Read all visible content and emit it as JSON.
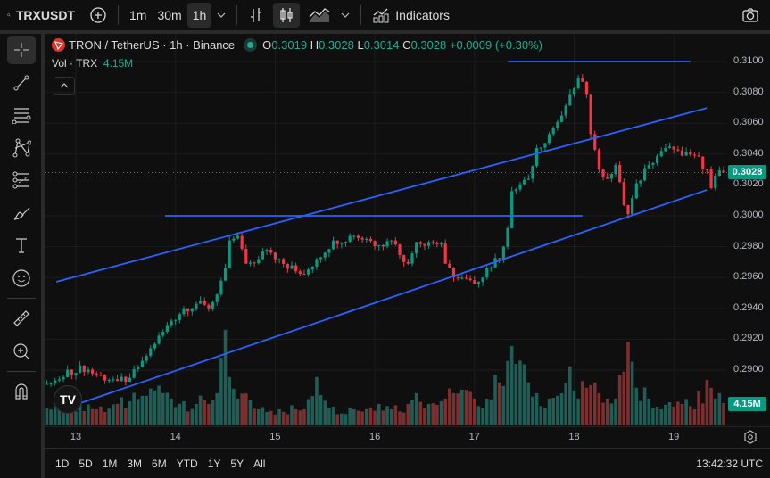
{
  "toolbar": {
    "symbol": "TRXUSDT",
    "intervals": [
      "1m",
      "30m",
      "1h"
    ],
    "active_interval": "1h",
    "indicators_label": "Indicators"
  },
  "legend": {
    "title": "TRON / TetherUS · 1h · Binance",
    "o_label": "O",
    "o": "0.3019",
    "h_label": "H",
    "h": "0.3028",
    "l_label": "L",
    "l": "0.3014",
    "c_label": "C",
    "c": "0.3028",
    "change": "+0.0009 (+0.30%)",
    "vol_label": "Vol · TRX",
    "vol": "4.15M"
  },
  "price_axis": {
    "ticks": [
      "0.3100",
      "0.3080",
      "0.3060",
      "0.3040",
      "0.3020",
      "0.3000",
      "0.2980",
      "0.2960",
      "0.2940",
      "0.2920",
      "0.2900"
    ],
    "current_price": "0.3028",
    "current_volume": "4.15M"
  },
  "time_axis": {
    "ticks": [
      "13",
      "14",
      "15",
      "16",
      "17",
      "18",
      "19"
    ]
  },
  "ranges": [
    "1D",
    "5D",
    "1M",
    "3M",
    "6M",
    "YTD",
    "1Y",
    "5Y",
    "All"
  ],
  "clock": "13:42:32 UTC",
  "colors": {
    "up": "#089981",
    "down": "#f23645",
    "vol_up": "#1f5e56",
    "vol_down": "#7b2f2f",
    "drawing": "#2962ff"
  },
  "chart_data": {
    "type": "candlestick",
    "interval": "1h",
    "ylim": [
      0.288,
      0.311
    ],
    "note_precision": "approximate closes read from chart",
    "path": [
      [
        "12 17:00",
        0.2891,
        3.2
      ],
      [
        "12 20:00",
        0.2894,
        3.5
      ],
      [
        "13 01:00",
        0.2903,
        4.5
      ],
      [
        "13 05:00",
        0.2897,
        3.0
      ],
      [
        "13 10:00",
        0.2893,
        4.0
      ],
      [
        "13 13:00",
        0.2895,
        4.5
      ],
      [
        "13 16:00",
        0.2906,
        5.5
      ],
      [
        "13 19:00",
        0.2917,
        6.5
      ],
      [
        "13 23:00",
        0.2932,
        5.0
      ],
      [
        "14 02:00",
        0.294,
        4.5
      ],
      [
        "14 05:00",
        0.2943,
        4.0
      ],
      [
        "14 08:00",
        0.294,
        4.0
      ],
      [
        "14 10:00",
        0.2949,
        6.0
      ],
      [
        "14 12:00",
        0.2966,
        17.8
      ],
      [
        "14 13:00",
        0.2984,
        9.0
      ],
      [
        "14 15:00",
        0.2987,
        5.0
      ],
      [
        "14 17:00",
        0.2969,
        6.0
      ],
      [
        "14 20:00",
        0.2972,
        3.0
      ],
      [
        "14 22:00",
        0.2978,
        2.5
      ],
      [
        "15 01:00",
        0.2972,
        3.0
      ],
      [
        "15 05:00",
        0.2964,
        3.0
      ],
      [
        "15 07:00",
        0.2962,
        3.0
      ],
      [
        "15 10:00",
        0.2972,
        9.0
      ],
      [
        "15 14:00",
        0.2984,
        3.5
      ],
      [
        "15 19:00",
        0.2987,
        3.0
      ],
      [
        "15 22:00",
        0.2985,
        3.0
      ],
      [
        "16 01:00",
        0.2981,
        4.0
      ],
      [
        "16 04:00",
        0.2984,
        3.0
      ],
      [
        "16 08:00",
        0.2969,
        4.0
      ],
      [
        "16 10:00",
        0.2983,
        6.0
      ],
      [
        "16 13:00",
        0.2983,
        4.0
      ],
      [
        "16 16:00",
        0.2982,
        4.5
      ],
      [
        "16 17:00",
        0.2969,
        5.0
      ],
      [
        "16 19:00",
        0.296,
        6.0
      ],
      [
        "17 00:00",
        0.2956,
        5.0
      ],
      [
        "17 03:00",
        0.2966,
        5.0
      ],
      [
        "17 06:00",
        0.2972,
        8.0
      ],
      [
        "17 08:00",
        0.2992,
        12.0
      ],
      [
        "17 09:00",
        0.3016,
        14.8
      ],
      [
        "17 13:00",
        0.3024,
        8.0
      ],
      [
        "17 15:00",
        0.3044,
        6.0
      ],
      [
        "17 18:00",
        0.3053,
        5.0
      ],
      [
        "17 21:00",
        0.3065,
        6.0
      ],
      [
        "17 23:00",
        0.3079,
        11.0
      ],
      [
        "18 01:00",
        0.3089,
        5.0
      ],
      [
        "18 03:00",
        0.3079,
        7.0
      ],
      [
        "18 04:00",
        0.3053,
        7.5
      ],
      [
        "18 06:00",
        0.303,
        6.0
      ],
      [
        "18 08:00",
        0.3024,
        5.0
      ],
      [
        "18 10:00",
        0.3033,
        5.0
      ],
      [
        "18 12:00",
        0.3007,
        10.0
      ],
      [
        "18 13:00",
        0.3001,
        15.5
      ],
      [
        "18 15:00",
        0.3021,
        7.0
      ],
      [
        "18 18:00",
        0.3033,
        5.0
      ],
      [
        "18 21:00",
        0.3042,
        3.0
      ],
      [
        "19 00:00",
        0.3043,
        3.5
      ],
      [
        "19 02:00",
        0.3039,
        4.0
      ],
      [
        "19 05:00",
        0.3039,
        3.0
      ],
      [
        "19 08:00",
        0.303,
        8.5
      ],
      [
        "19 09:00",
        0.3018,
        7.0
      ],
      [
        "19 10:00",
        0.3026,
        5.0
      ],
      [
        "19 12:00",
        0.3028,
        4.15
      ]
    ],
    "path_columns": [
      "time",
      "close",
      "volume_M"
    ],
    "drawings": [
      {
        "type": "trend",
        "from": [
          "12 19:18",
          0.29572
        ],
        "to": [
          "19 08:00",
          0.30699
        ]
      },
      {
        "type": "trend",
        "from": [
          "13 01:06",
          0.28786
        ],
        "to": [
          "19 08:00",
          0.30168
        ]
      },
      {
        "type": "horizontal",
        "from": [
          "13 21:30",
          0.3
        ],
        "to": [
          "18 02:00",
          0.3
        ]
      },
      {
        "type": "horizontal",
        "from": [
          "17 08:00",
          0.31
        ],
        "to": [
          "19 04:00",
          0.31
        ]
      }
    ]
  }
}
